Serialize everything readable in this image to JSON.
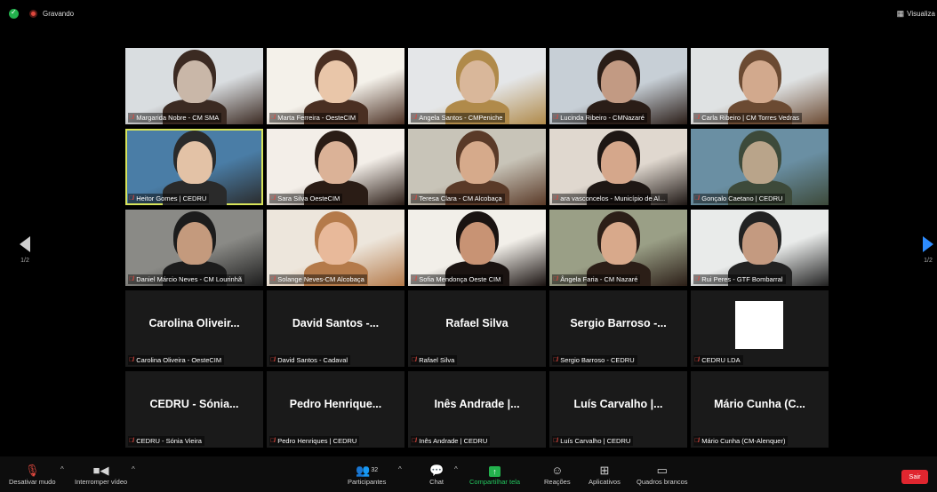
{
  "recording": {
    "label": "Gravando"
  },
  "view_button": {
    "label": "Visualiza"
  },
  "pagination": {
    "left": "1/2",
    "right": "1/2"
  },
  "tiles": [
    {
      "name": "Margarida Nobre - CM SMA",
      "kind": "video"
    },
    {
      "name": "Marta Ferreira - OesteCIM",
      "kind": "video"
    },
    {
      "name": "Angela Santos - CMPeniche",
      "kind": "video"
    },
    {
      "name": "Lucinda Ribeiro - CMNazaré",
      "kind": "video"
    },
    {
      "name": "Carla Ribeiro | CM Torres Vedras",
      "kind": "video"
    },
    {
      "name": "Heitor Gomes | CEDRU",
      "kind": "video",
      "active": true
    },
    {
      "name": "Sara Silva OesteCIM",
      "kind": "video"
    },
    {
      "name": "Teresa Clara - CM Alcobaça",
      "kind": "video"
    },
    {
      "name": "ara vasconcelos - Município de Al...",
      "kind": "video"
    },
    {
      "name": "Gonçalo Caetano | CEDRU",
      "kind": "video"
    },
    {
      "name": "Daniel Márcio Neves - CM Lourinhã",
      "kind": "video"
    },
    {
      "name": "Solange Neves-CM Alcobaça",
      "kind": "video"
    },
    {
      "name": "Sofia Mendonça Oeste CIM",
      "kind": "video"
    },
    {
      "name": "Ângela Faria - CM Nazaré",
      "kind": "video"
    },
    {
      "name": "Rui Peres - GTF Bombarral",
      "kind": "video"
    },
    {
      "name": "Carolina Oliveira - OesteCIM",
      "display": "Carolina Oliveir...",
      "kind": "name"
    },
    {
      "name": "David Santos - Cadaval",
      "display": "David Santos -...",
      "kind": "name"
    },
    {
      "name": "Rafael Silva",
      "display": "Rafael Silva",
      "kind": "name"
    },
    {
      "name": "Sergio Barroso - CEDRU",
      "display": "Sergio Barroso -...",
      "kind": "name"
    },
    {
      "name": "CEDRU LDA",
      "display": "",
      "kind": "picture"
    },
    {
      "name": "CEDRU - Sónia Vieira",
      "display": "CEDRU - Sónia...",
      "kind": "name"
    },
    {
      "name": "Pedro Henriques | CEDRU",
      "display": "Pedro Henrique...",
      "kind": "name"
    },
    {
      "name": "Inês Andrade | CEDRU",
      "display": "Inês Andrade |...",
      "kind": "name"
    },
    {
      "name": "Luís Carvalho | CEDRU",
      "display": "Luís Carvalho |...",
      "kind": "name"
    },
    {
      "name": "Mário Cunha (CM-Alenquer)",
      "display": "Mário Cunha (C...",
      "kind": "name"
    }
  ],
  "toolbar": {
    "mute": "Desativar mudo",
    "video": "Interromper vídeo",
    "participants": "Participantes",
    "participants_count": "32",
    "chat": "Chat",
    "share": "Compartilhar tela",
    "reactions": "Reações",
    "apps": "Aplicativos",
    "whiteboards": "Quadros brancos",
    "leave": "Sair"
  },
  "colors": {
    "muted_icon": "#e0483e",
    "active_speaker": "#d7e35a",
    "share_green": "#23b14d",
    "leave_red": "#e0262f",
    "nav_blue": "#2d8cff"
  }
}
